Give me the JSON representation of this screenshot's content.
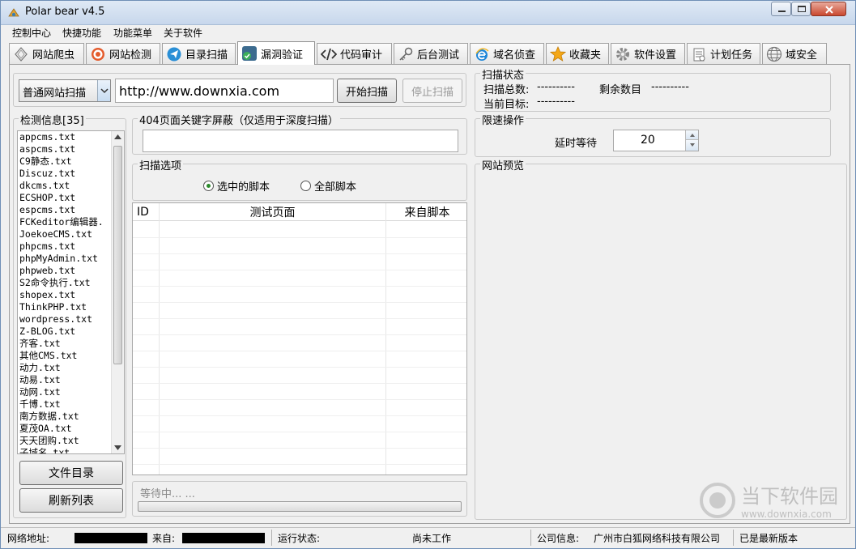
{
  "window": {
    "title": "Polar bear v4.5"
  },
  "menu": [
    "控制中心",
    "快捷功能",
    "功能菜单",
    "关于软件"
  ],
  "tabs": [
    {
      "label": "网站爬虫",
      "icon": "spider-icon"
    },
    {
      "label": "网站检测",
      "icon": "target-icon"
    },
    {
      "label": "目录扫描",
      "icon": "paper-plane-icon"
    },
    {
      "label": "漏洞验证",
      "icon": "shield-check-icon",
      "active": true
    },
    {
      "label": "代码审计",
      "icon": "code-icon"
    },
    {
      "label": "后台测试",
      "icon": "key-icon"
    },
    {
      "label": "域名侦查",
      "icon": "browser-e-icon"
    },
    {
      "label": "收藏夹",
      "icon": "star-icon"
    },
    {
      "label": "软件设置",
      "icon": "gear-icon"
    },
    {
      "label": "计划任务",
      "icon": "clipboard-icon"
    },
    {
      "label": "域安全",
      "icon": "globe-icon"
    }
  ],
  "scan": {
    "mode_value": "普通网站扫描",
    "url_value": "http://www.downxia.com",
    "start_label": "开始扫描",
    "stop_label": "停止扫描"
  },
  "scan_status": {
    "legend": "扫描状态",
    "total_label": "扫描总数:",
    "total_value": "----------",
    "remaining_label": "剩余数目",
    "remaining_value": "----------",
    "target_label": "当前目标:",
    "target_value": "----------"
  },
  "detect": {
    "legend": "检测信息[35]",
    "items": [
      "appcms.txt",
      "aspcms.txt",
      "C9静态.txt",
      "Discuz.txt",
      "dkcms.txt",
      "ECSHOP.txt",
      "espcms.txt",
      "FCKeditor编辑器.",
      "JoekoeCMS.txt",
      "phpcms.txt",
      "phpMyAdmin.txt",
      "phpweb.txt",
      "S2命令执行.txt",
      "shopex.txt",
      "ThinkPHP.txt",
      "wordpress.txt",
      "Z-BLOG.txt",
      "齐客.txt",
      "其他CMS.txt",
      "动力.txt",
      "动易.txt",
      "动网.txt",
      "千博.txt",
      "南方数据.txt",
      "夏茂OA.txt",
      "天天团购.txt",
      "子域名.txt"
    ],
    "dir_button": "文件目录",
    "refresh_button": "刷新列表"
  },
  "keyword_block": {
    "legend": "404页面关键字屏蔽（仅适用于深度扫描）",
    "value": ""
  },
  "scan_options": {
    "legend": "扫描选项",
    "selected_label": "选中的脚本",
    "all_label": "全部脚本",
    "selected": "selected"
  },
  "results": {
    "col_id": "ID",
    "col_page": "测试页面",
    "col_script": "来自脚本",
    "rows": []
  },
  "progress": {
    "label": "等待中... ...",
    "percent": 0
  },
  "rate_limit": {
    "legend": "限速操作",
    "delay_label": "延时等待",
    "delay_value": "20"
  },
  "preview": {
    "legend": "网站预览"
  },
  "status": {
    "net_label": "网络地址:",
    "from_label": "来自:",
    "run_label": "运行状态:",
    "run_value": "尚未工作",
    "company_label": "公司信息:",
    "company_value": "广州市白狐网络科技有限公司",
    "version_value": "已是最新版本"
  },
  "watermark": {
    "text": "当下软件园",
    "url": "www.downxia.com"
  },
  "colors": {
    "title_bg": "#c7d7ec",
    "accent": "#3c7fb1",
    "close": "#c9482f"
  }
}
